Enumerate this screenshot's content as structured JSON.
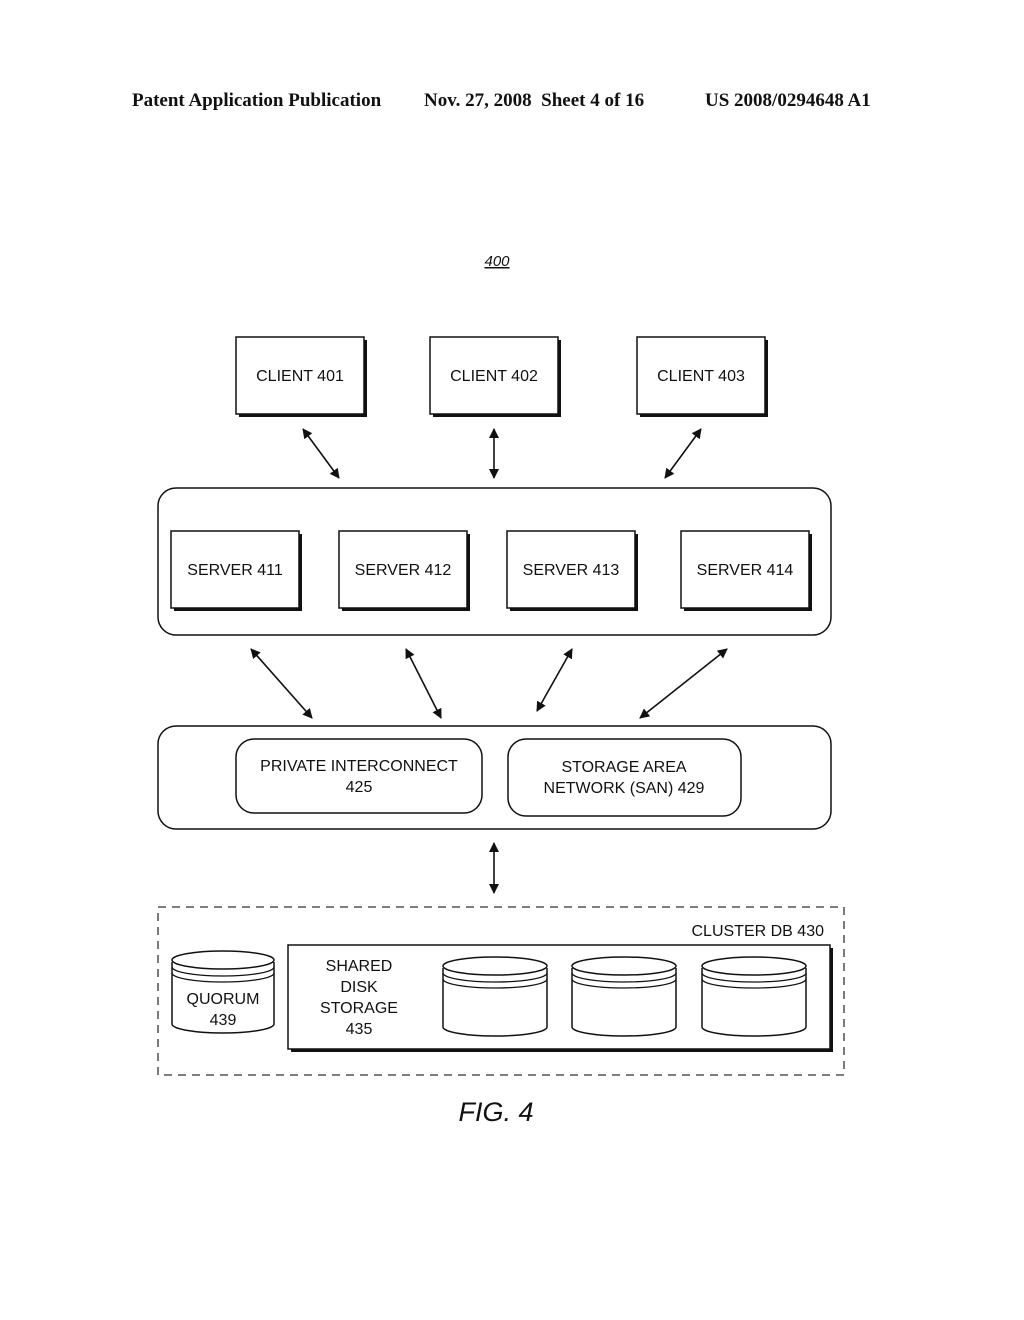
{
  "header": {
    "publication": "Patent Application Publication",
    "date_sheet": "Nov. 27, 2008  Sheet 4 of 16",
    "patent_number": "US 2008/0294648 A1"
  },
  "figure": {
    "reference": "400",
    "caption": "FIG. 4",
    "clients": [
      "CLIENT 401",
      "CLIENT 402",
      "CLIENT 403"
    ],
    "servers": [
      "SERVER 411",
      "SERVER 412",
      "SERVER 413",
      "SERVER 414"
    ],
    "interconnect": {
      "private_line1": "PRIVATE INTERCONNECT",
      "private_line2": "425",
      "san_line1": "STORAGE AREA",
      "san_line2": "NETWORK (SAN) 429"
    },
    "cluster_db": {
      "label": "CLUSTER DB 430",
      "quorum_line1": "QUORUM",
      "quorum_line2": "439",
      "shared_line1": "SHARED",
      "shared_line2": "DISK",
      "shared_line3": "STORAGE",
      "shared_line4": "435"
    }
  }
}
